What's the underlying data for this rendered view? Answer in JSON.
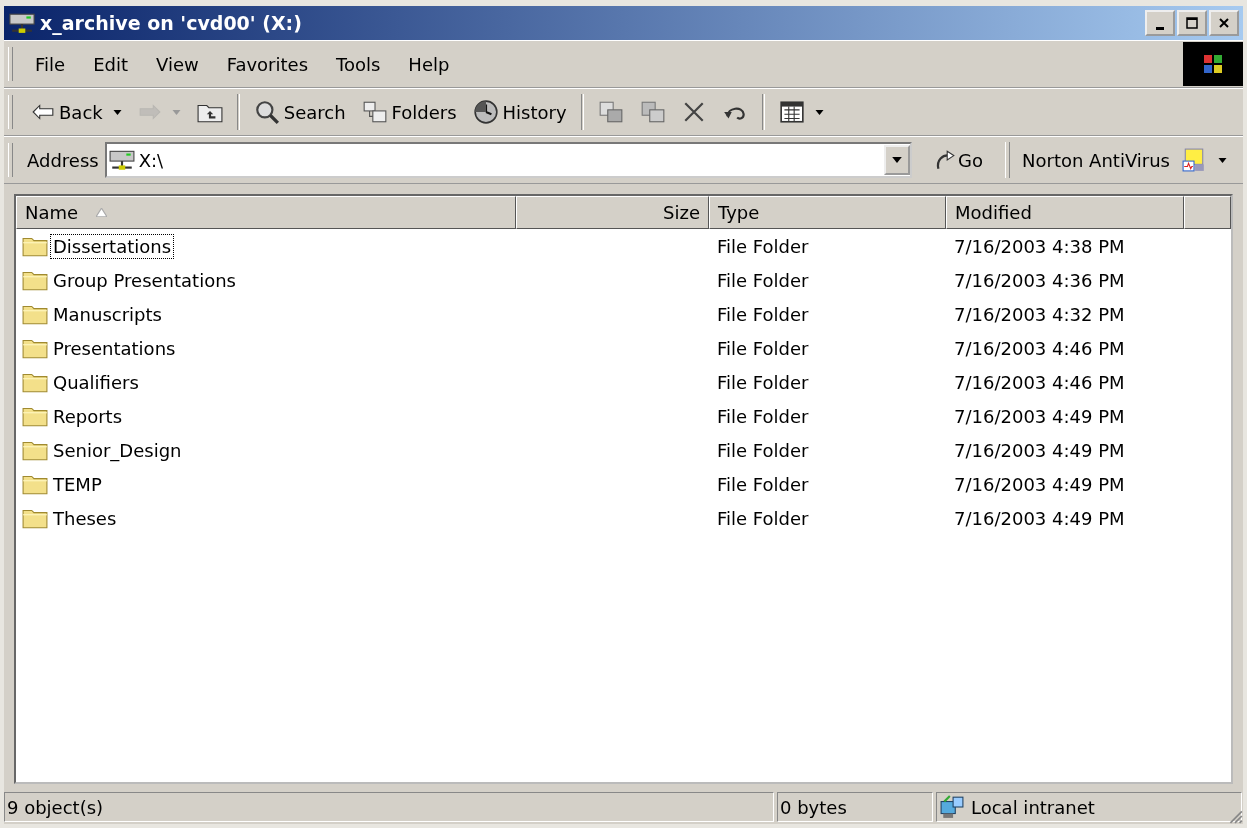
{
  "window": {
    "title": "x_archive on 'cvd00' (X:)"
  },
  "menu": [
    "File",
    "Edit",
    "View",
    "Favorites",
    "Tools",
    "Help"
  ],
  "toolbar": [
    {
      "kind": "button",
      "label": "Back",
      "dropdown": true,
      "disabled": false
    },
    {
      "kind": "icon",
      "dropdown": true,
      "disabled": true
    },
    {
      "kind": "icon",
      "dropdown": false,
      "disabled": false
    },
    {
      "kind": "separator"
    },
    {
      "kind": "button",
      "label": "Search",
      "dropdown": false,
      "disabled": false
    },
    {
      "kind": "button",
      "label": "Folders",
      "dropdown": false,
      "disabled": false
    },
    {
      "kind": "button",
      "label": "History",
      "dropdown": false,
      "disabled": false
    },
    {
      "kind": "separator"
    },
    {
      "kind": "icon",
      "dropdown": false,
      "disabled": false
    },
    {
      "kind": "icon",
      "dropdown": false,
      "disabled": false
    },
    {
      "kind": "icon",
      "dropdown": false,
      "disabled": false
    },
    {
      "kind": "icon",
      "dropdown": false,
      "disabled": false
    },
    {
      "kind": "separator"
    },
    {
      "kind": "icon",
      "dropdown": true,
      "disabled": false
    }
  ],
  "address": {
    "label": "Address",
    "value": "X:\\",
    "go": "Go",
    "extension": "Norton AntiVirus"
  },
  "columns": [
    {
      "label": "Name",
      "sorted": true
    },
    {
      "label": "Size",
      "sorted": false
    },
    {
      "label": "Type",
      "sorted": false
    },
    {
      "label": "Modified",
      "sorted": false
    }
  ],
  "rows": [
    {
      "name": "Dissertations",
      "type": "File Folder",
      "modified": "7/16/2003 4:38 PM",
      "focused": true
    },
    {
      "name": "Group Presentations",
      "type": "File Folder",
      "modified": "7/16/2003 4:36 PM",
      "focused": false
    },
    {
      "name": "Manuscripts",
      "type": "File Folder",
      "modified": "7/16/2003 4:32 PM",
      "focused": false
    },
    {
      "name": "Presentations",
      "type": "File Folder",
      "modified": "7/16/2003 4:46 PM",
      "focused": false
    },
    {
      "name": "Qualifiers",
      "type": "File Folder",
      "modified": "7/16/2003 4:46 PM",
      "focused": false
    },
    {
      "name": "Reports",
      "type": "File Folder",
      "modified": "7/16/2003 4:49 PM",
      "focused": false
    },
    {
      "name": "Senior_Design",
      "type": "File Folder",
      "modified": "7/16/2003 4:49 PM",
      "focused": false
    },
    {
      "name": "TEMP",
      "type": "File Folder",
      "modified": "7/16/2003 4:49 PM",
      "focused": false
    },
    {
      "name": "Theses",
      "type": "File Folder",
      "modified": "7/16/2003 4:49 PM",
      "focused": false
    }
  ],
  "status_bar": {
    "objects": "9 object(s)",
    "size": "0 bytes",
    "zone": "Local intranet"
  }
}
